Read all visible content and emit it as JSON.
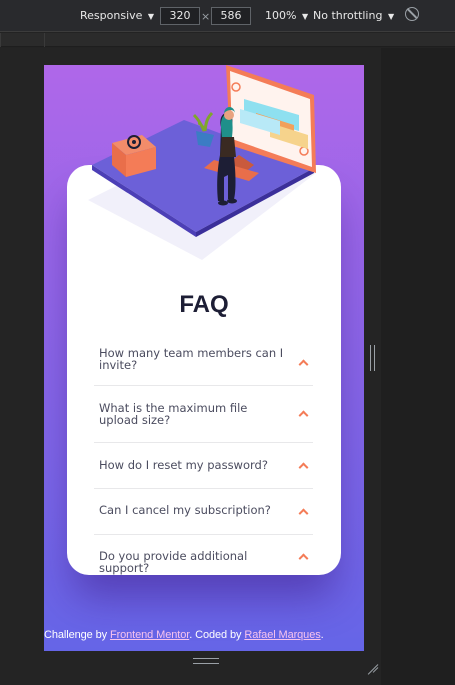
{
  "devtools": {
    "device_mode": "Responsive",
    "width": "320",
    "height": "586",
    "dim_separator": "×",
    "zoom": "100%",
    "throttling": "No throttling",
    "caret_glyph": "▼",
    "rotate_icon": "rotate-icon"
  },
  "page": {
    "title": "FAQ",
    "faqs": [
      {
        "question": "How many team members can I invite?"
      },
      {
        "question": "What is the maximum file upload size?"
      },
      {
        "question": "How do I reset my password?"
      },
      {
        "question": "Can I cancel my subscription?"
      },
      {
        "question": "Do you provide additional support?"
      }
    ],
    "attribution": {
      "prefix": "Challenge by ",
      "link1": "Frontend Mentor",
      "middle": ". Coded by ",
      "link2": "Rafael Marques",
      "suffix": "."
    }
  },
  "colors": {
    "gradient_top": "#af67e9",
    "gradient_bottom": "#6565e7",
    "title": "#1d1e35",
    "question": "#4b4c5f",
    "arrow": "#f47c57",
    "link": "#f6c2ee"
  }
}
